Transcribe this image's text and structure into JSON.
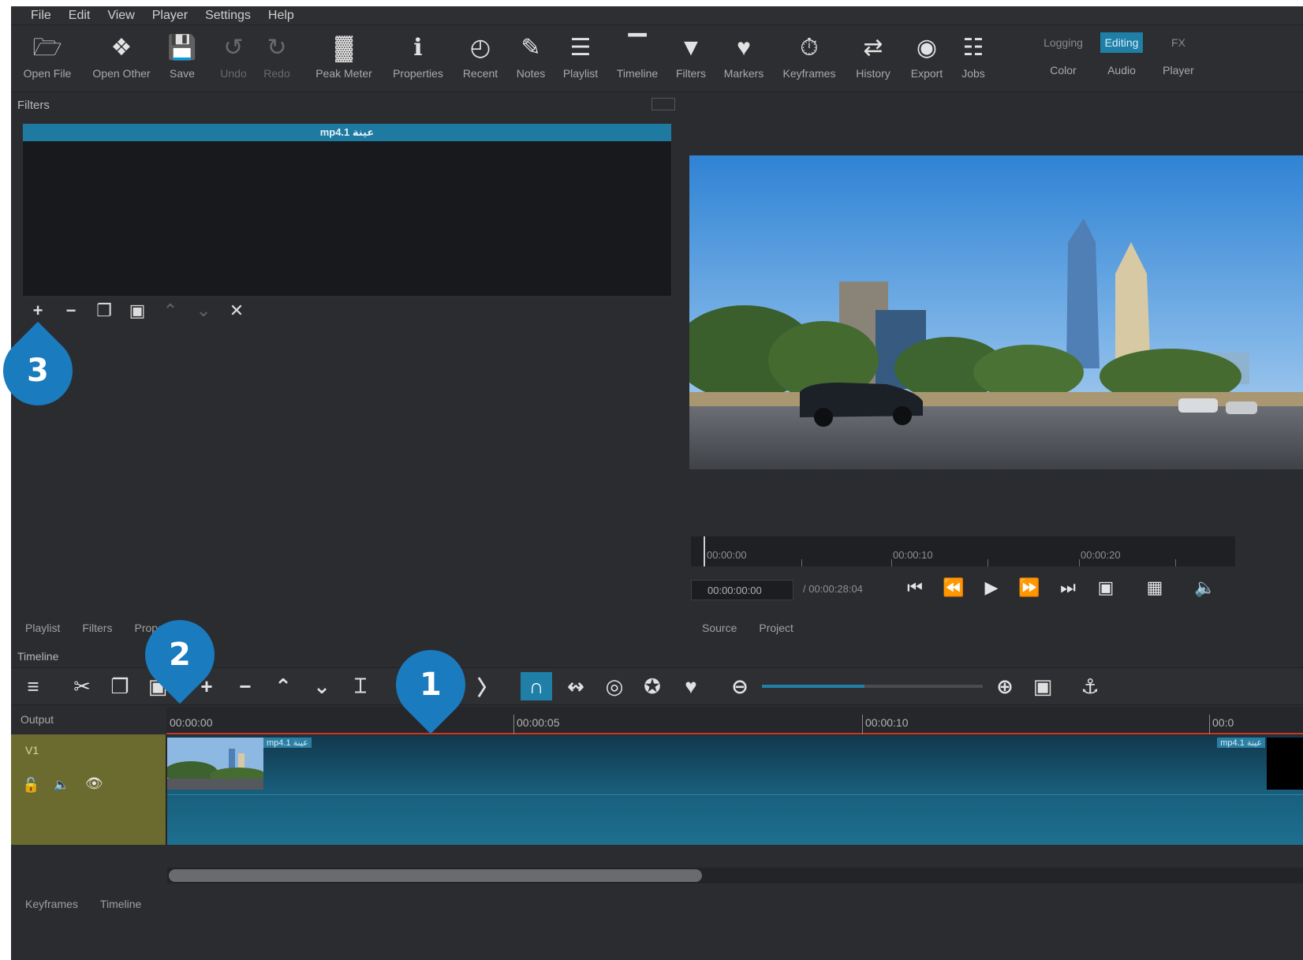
{
  "menu": [
    "File",
    "Edit",
    "View",
    "Player",
    "Settings",
    "Help"
  ],
  "toolbar": [
    {
      "label": "Open File",
      "icon": "folder-icon",
      "glyph": "🗁"
    },
    {
      "label": "Open Other",
      "icon": "open-other-icon",
      "glyph": "❖"
    },
    {
      "label": "Save",
      "icon": "save-icon",
      "glyph": "💾"
    },
    {
      "label": "Undo",
      "icon": "undo-icon",
      "glyph": "↺"
    },
    {
      "label": "Redo",
      "icon": "redo-icon",
      "glyph": "↻"
    },
    {
      "label": "Peak Meter",
      "icon": "peak-meter-icon",
      "glyph": "▓"
    },
    {
      "label": "Properties",
      "icon": "info-icon",
      "glyph": "ℹ"
    },
    {
      "label": "Recent",
      "icon": "clock-icon",
      "glyph": "◴"
    },
    {
      "label": "Notes",
      "icon": "notes-icon",
      "glyph": "✎"
    },
    {
      "label": "Playlist",
      "icon": "list-icon",
      "glyph": "☰"
    },
    {
      "label": "Timeline",
      "icon": "timeline-icon",
      "glyph": "▔"
    },
    {
      "label": "Filters",
      "icon": "funnel-icon",
      "glyph": "▼"
    },
    {
      "label": "Markers",
      "icon": "marker-icon",
      "glyph": "♥"
    },
    {
      "label": "Keyframes",
      "icon": "stopwatch-icon",
      "glyph": "⏱"
    },
    {
      "label": "History",
      "icon": "history-icon",
      "glyph": "⇄"
    },
    {
      "label": "Export",
      "icon": "export-icon",
      "glyph": "◉"
    },
    {
      "label": "Jobs",
      "icon": "jobs-icon",
      "glyph": "☷"
    }
  ],
  "layouts": [
    {
      "top": "Logging",
      "bottom": "Color"
    },
    {
      "top": "Editing",
      "bottom": "Audio"
    },
    {
      "top": "FX",
      "bottom": "Player"
    }
  ],
  "filters_panel": {
    "title": "Filters",
    "selected_clip": "mp4.1 عينة"
  },
  "filter_buttons": [
    "+",
    "−",
    "❐",
    "▣",
    "⌃",
    "⌄",
    "✕"
  ],
  "player": {
    "ruler_labels": [
      "00:00:00",
      "00:00:10",
      "00:00:20"
    ],
    "timecode": "00:00:00:00",
    "total": "/ 00:00:28:04",
    "controls": [
      "⏮",
      "⏪",
      "▶",
      "⏩",
      "⏭",
      "▣",
      "▦",
      "🔈"
    ]
  },
  "left_tabs": [
    "Playlist",
    "Filters",
    "Properties"
  ],
  "right_tabs": [
    "Source",
    "Project"
  ],
  "timeline": {
    "title": "Timeline",
    "output_label": "Output",
    "track_name": "V1",
    "ruler_labels": [
      "00:00:00",
      "00:00:05",
      "00:00:10",
      "00:0"
    ],
    "clip_name": "mp4.1 عينة",
    "clip_name_end": "mp4.1 عينة",
    "tools": [
      "≡",
      "✂",
      "❐",
      "▣",
      "+",
      "−",
      "⌃",
      "⌄",
      "⌶",
      "〈",
      "〉",
      "∩",
      "↭",
      "◎",
      "✪",
      "♥",
      "⊖",
      "⊕",
      "▣",
      "⚓"
    ]
  },
  "bottom_tabs": [
    "Keyframes",
    "Timeline"
  ],
  "callouts": [
    "1",
    "2",
    "3"
  ],
  "colors": {
    "accent": "#1f7fa6",
    "callout": "#1a7bbf",
    "track": "#6b6a2f",
    "clip": "#19607e"
  }
}
